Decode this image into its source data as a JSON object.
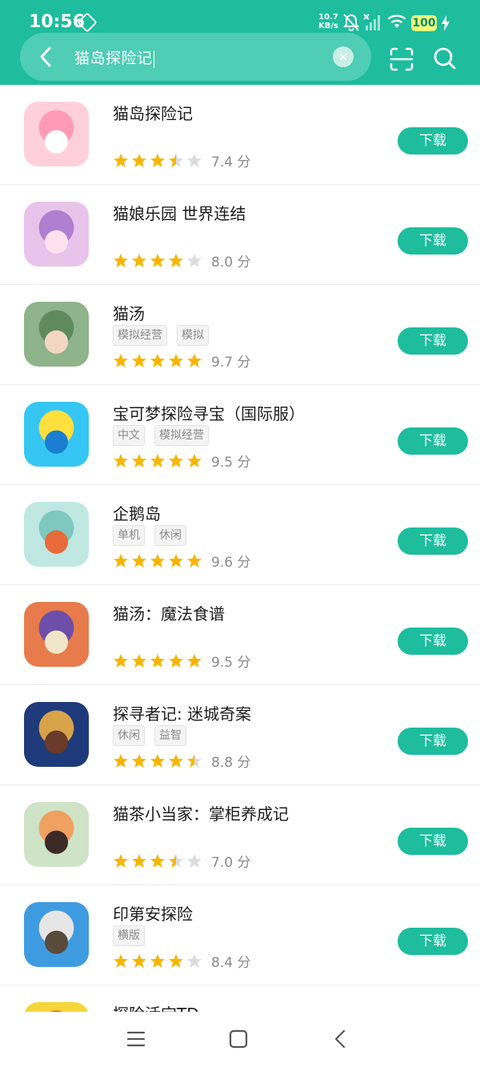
{
  "status": {
    "time": "10:56",
    "net_speed_value": "10.7",
    "net_speed_unit": "KB/s",
    "battery": "100",
    "icons": [
      "gem-icon",
      "mute-bell-icon",
      "no-signal-icon",
      "wifi-icon",
      "battery-icon",
      "charging-icon"
    ]
  },
  "search": {
    "query": "猫岛探险记",
    "clear_symbol": "×",
    "icons": [
      "back-arrow-icon",
      "clear-icon",
      "scan-icon",
      "search-icon"
    ]
  },
  "download_label": "下载",
  "results": [
    {
      "title": "猫岛探险记",
      "tags": [],
      "rating": 3.5,
      "score": "7.4 分"
    },
    {
      "title": "猫娘乐园 世界连结",
      "tags": [],
      "rating": 4,
      "score": "8.0 分"
    },
    {
      "title": "猫汤",
      "tags": [
        "模拟经营",
        "模拟"
      ],
      "rating": 5,
      "score": "9.7 分"
    },
    {
      "title": "宝可梦探险寻宝（国际服）",
      "tags": [
        "中文",
        "模拟经营"
      ],
      "rating": 5,
      "score": "9.5 分"
    },
    {
      "title": "企鹅岛",
      "tags": [
        "单机",
        "休闲"
      ],
      "rating": 5,
      "score": "9.6 分"
    },
    {
      "title": "猫汤：魔法食谱",
      "tags": [],
      "rating": 5,
      "score": "9.5 分"
    },
    {
      "title": "探寻者记: 迷城奇案",
      "tags": [
        "休闲",
        "益智"
      ],
      "rating": 4.5,
      "score": "8.8 分"
    },
    {
      "title": "猫茶小当家：掌柜养成记",
      "tags": [],
      "rating": 3.5,
      "score": "7.0 分"
    },
    {
      "title": "印第安探险",
      "tags": [
        "横版"
      ],
      "rating": 4,
      "score": "8.4 分"
    },
    {
      "title": "探险活宝TD",
      "tags": [],
      "rating": null,
      "score": ""
    }
  ],
  "navbar": {
    "icons": [
      "menu-icon",
      "home-icon",
      "back-icon"
    ]
  },
  "colors": {
    "accent": "#1dbd9e",
    "star": "#f7b500",
    "star_empty": "#dcdcdc"
  }
}
